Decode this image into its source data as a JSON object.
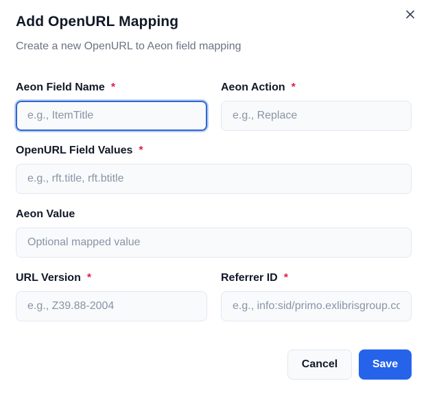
{
  "dialog": {
    "title": "Add OpenURL Mapping",
    "subtitle": "Create a new OpenURL to Aeon field mapping",
    "close_icon": "close-icon"
  },
  "fields": {
    "aeon_field_name": {
      "label": "Aeon Field Name",
      "required_mark": "*",
      "placeholder": "e.g., ItemTitle",
      "value": ""
    },
    "aeon_action": {
      "label": "Aeon Action",
      "required_mark": "*",
      "placeholder": "e.g., Replace",
      "value": ""
    },
    "openurl_field_values": {
      "label": "OpenURL Field Values",
      "required_mark": "*",
      "placeholder": "e.g., rft.title, rft.btitle",
      "value": ""
    },
    "aeon_value": {
      "label": "Aeon Value",
      "placeholder": "Optional mapped value",
      "value": ""
    },
    "url_version": {
      "label": "URL Version",
      "required_mark": "*",
      "placeholder": "e.g., Z39.88-2004",
      "value": ""
    },
    "referrer_id": {
      "label": "Referrer ID",
      "required_mark": "*",
      "placeholder": "e.g., info:sid/primo.exlibrisgroup.com",
      "value": ""
    }
  },
  "actions": {
    "cancel_label": "Cancel",
    "save_label": "Save"
  },
  "colors": {
    "primary": "#2563eb",
    "required": "#e11d48",
    "focus_ring": "#2f66d6"
  }
}
